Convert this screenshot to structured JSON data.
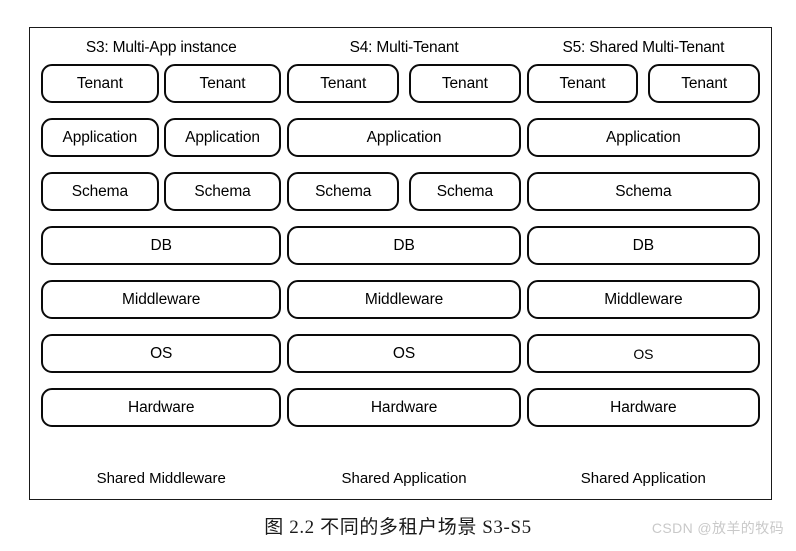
{
  "figure": {
    "caption": "图 2.2 不同的多租户场景 S3-S5",
    "watermark": "CSDN @放羊的牧码",
    "columns": [
      {
        "title": "S3: Multi-App instance",
        "footer": "Shared Middleware",
        "rows": [
          {
            "name": "tenant",
            "boxes": [
              "Tenant",
              "Tenant"
            ]
          },
          {
            "name": "application",
            "boxes": [
              "Application",
              "Application"
            ]
          },
          {
            "name": "schema",
            "boxes": [
              "Schema",
              "Schema"
            ]
          },
          {
            "name": "db",
            "boxes": [
              "DB"
            ]
          },
          {
            "name": "middleware",
            "boxes": [
              "Middleware"
            ]
          },
          {
            "name": "os",
            "boxes": [
              "OS"
            ]
          },
          {
            "name": "hardware",
            "boxes": [
              "Hardware"
            ]
          }
        ]
      },
      {
        "title": "S4: Multi-Tenant",
        "footer": "Shared Application",
        "rows": [
          {
            "name": "tenant",
            "boxes": [
              "Tenant",
              "Tenant"
            ]
          },
          {
            "name": "application",
            "boxes": [
              "Application"
            ]
          },
          {
            "name": "schema",
            "boxes": [
              "Schema",
              "Schema"
            ]
          },
          {
            "name": "db",
            "boxes": [
              "DB"
            ]
          },
          {
            "name": "middleware",
            "boxes": [
              "Middleware"
            ]
          },
          {
            "name": "os",
            "boxes": [
              "OS"
            ]
          },
          {
            "name": "hardware",
            "boxes": [
              "Hardware"
            ]
          }
        ]
      },
      {
        "title": "S5: Shared Multi-Tenant",
        "footer": "Shared Application",
        "rows": [
          {
            "name": "tenant",
            "boxes": [
              "Tenant",
              "Tenant"
            ]
          },
          {
            "name": "application",
            "boxes": [
              "Application"
            ]
          },
          {
            "name": "schema",
            "boxes": [
              "Schema"
            ]
          },
          {
            "name": "db",
            "boxes": [
              "DB"
            ]
          },
          {
            "name": "middleware",
            "boxes": [
              "Middleware"
            ]
          },
          {
            "name": "os",
            "boxes": [
              "OS"
            ]
          },
          {
            "name": "hardware",
            "boxes": [
              "Hardware"
            ]
          }
        ]
      }
    ]
  },
  "colors": {
    "frame_border": "#1a1a1a",
    "box_border": "#0a0a0a",
    "background": "#ffffff",
    "text": "#000000",
    "watermark": "#c9c9c9"
  }
}
